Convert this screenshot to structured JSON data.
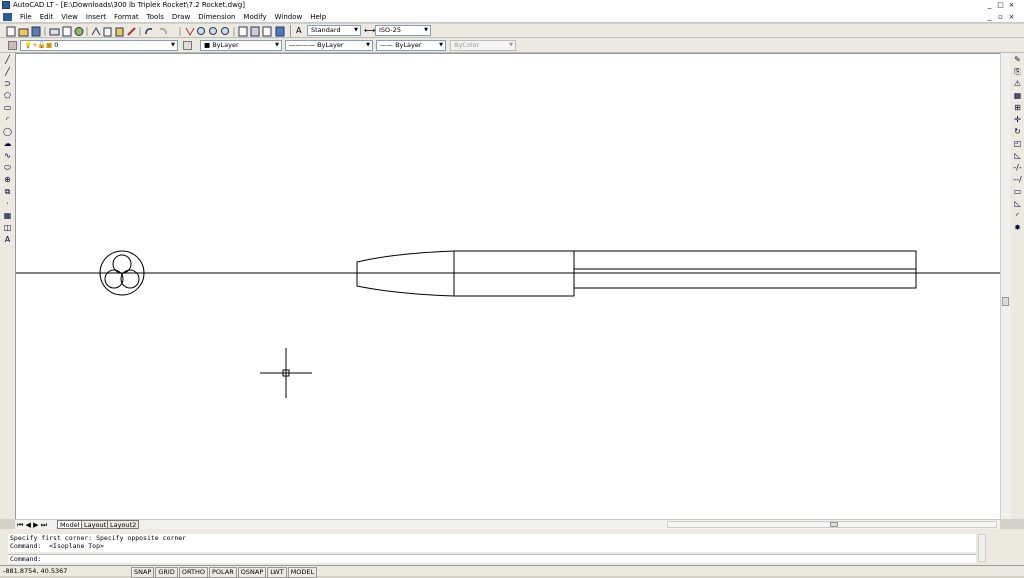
{
  "window": {
    "title": "AutoCAD LT - [E:\\Downloads\\300 lb Triplex Rocket\\7.2 Rocket.dwg]"
  },
  "menu": [
    "File",
    "Edit",
    "View",
    "Insert",
    "Format",
    "Tools",
    "Draw",
    "Dimension",
    "Modify",
    "Window",
    "Help"
  ],
  "styles_toolbar": {
    "text_style": "Standard",
    "dim_style": "ISO-25"
  },
  "properties_toolbar": {
    "layer": "0",
    "color": "ByLayer",
    "linetype": "ByLayer",
    "lineweight": "ByLayer",
    "plotstyle": "ByColor"
  },
  "draw_palette": [
    "line-icon",
    "construction-line-icon",
    "polyline-icon",
    "polygon-icon",
    "rectangle-icon",
    "arc-icon",
    "circle-icon",
    "revision-cloud-icon",
    "spline-icon",
    "ellipse-icon",
    "insert-block-icon",
    "make-block-icon",
    "point-icon",
    "hatch-icon",
    "region-icon",
    "multiline-text-icon"
  ],
  "draw_palette_glyphs": [
    "╱",
    "╱",
    "⊃",
    "⬠",
    "▭",
    "◜",
    "◯",
    "☁",
    "∿",
    "⬭",
    "⊕",
    "⧉",
    "·",
    "▦",
    "◫",
    "A"
  ],
  "modify_palette": [
    "erase-icon",
    "copy-icon",
    "mirror-icon",
    "offset-icon",
    "array-icon",
    "move-icon",
    "rotate-icon",
    "scale-icon",
    "stretch-icon",
    "trim-icon",
    "extend-icon",
    "break-icon",
    "chamfer-icon",
    "fillet-icon",
    "explode-icon"
  ],
  "modify_palette_glyphs": [
    "✎",
    "⎘",
    "⚠",
    "▦",
    "⊞",
    "✛",
    "↻",
    "◰",
    "◺",
    "-/-",
    "--/",
    "▭",
    "◺",
    "◜",
    "✸"
  ],
  "layout_tabs": [
    "Model",
    "Layout1",
    "Layout2"
  ],
  "command_history": [
    "Specify first corner: Specify opposite corner",
    "Command:  <Isoplane Top>"
  ],
  "command_prompt": "Command:",
  "status": {
    "coordinates": "-881.8754,  40.5367",
    "buttons": [
      "SNAP",
      "GRID",
      "ORTHO",
      "POLAR",
      "OSNAP",
      "LWT",
      "MODEL"
    ]
  },
  "colors": {
    "canvas_bg": "#ffffff",
    "toolbar_bg": "#ece9e0",
    "drawing_line": "#000000"
  }
}
